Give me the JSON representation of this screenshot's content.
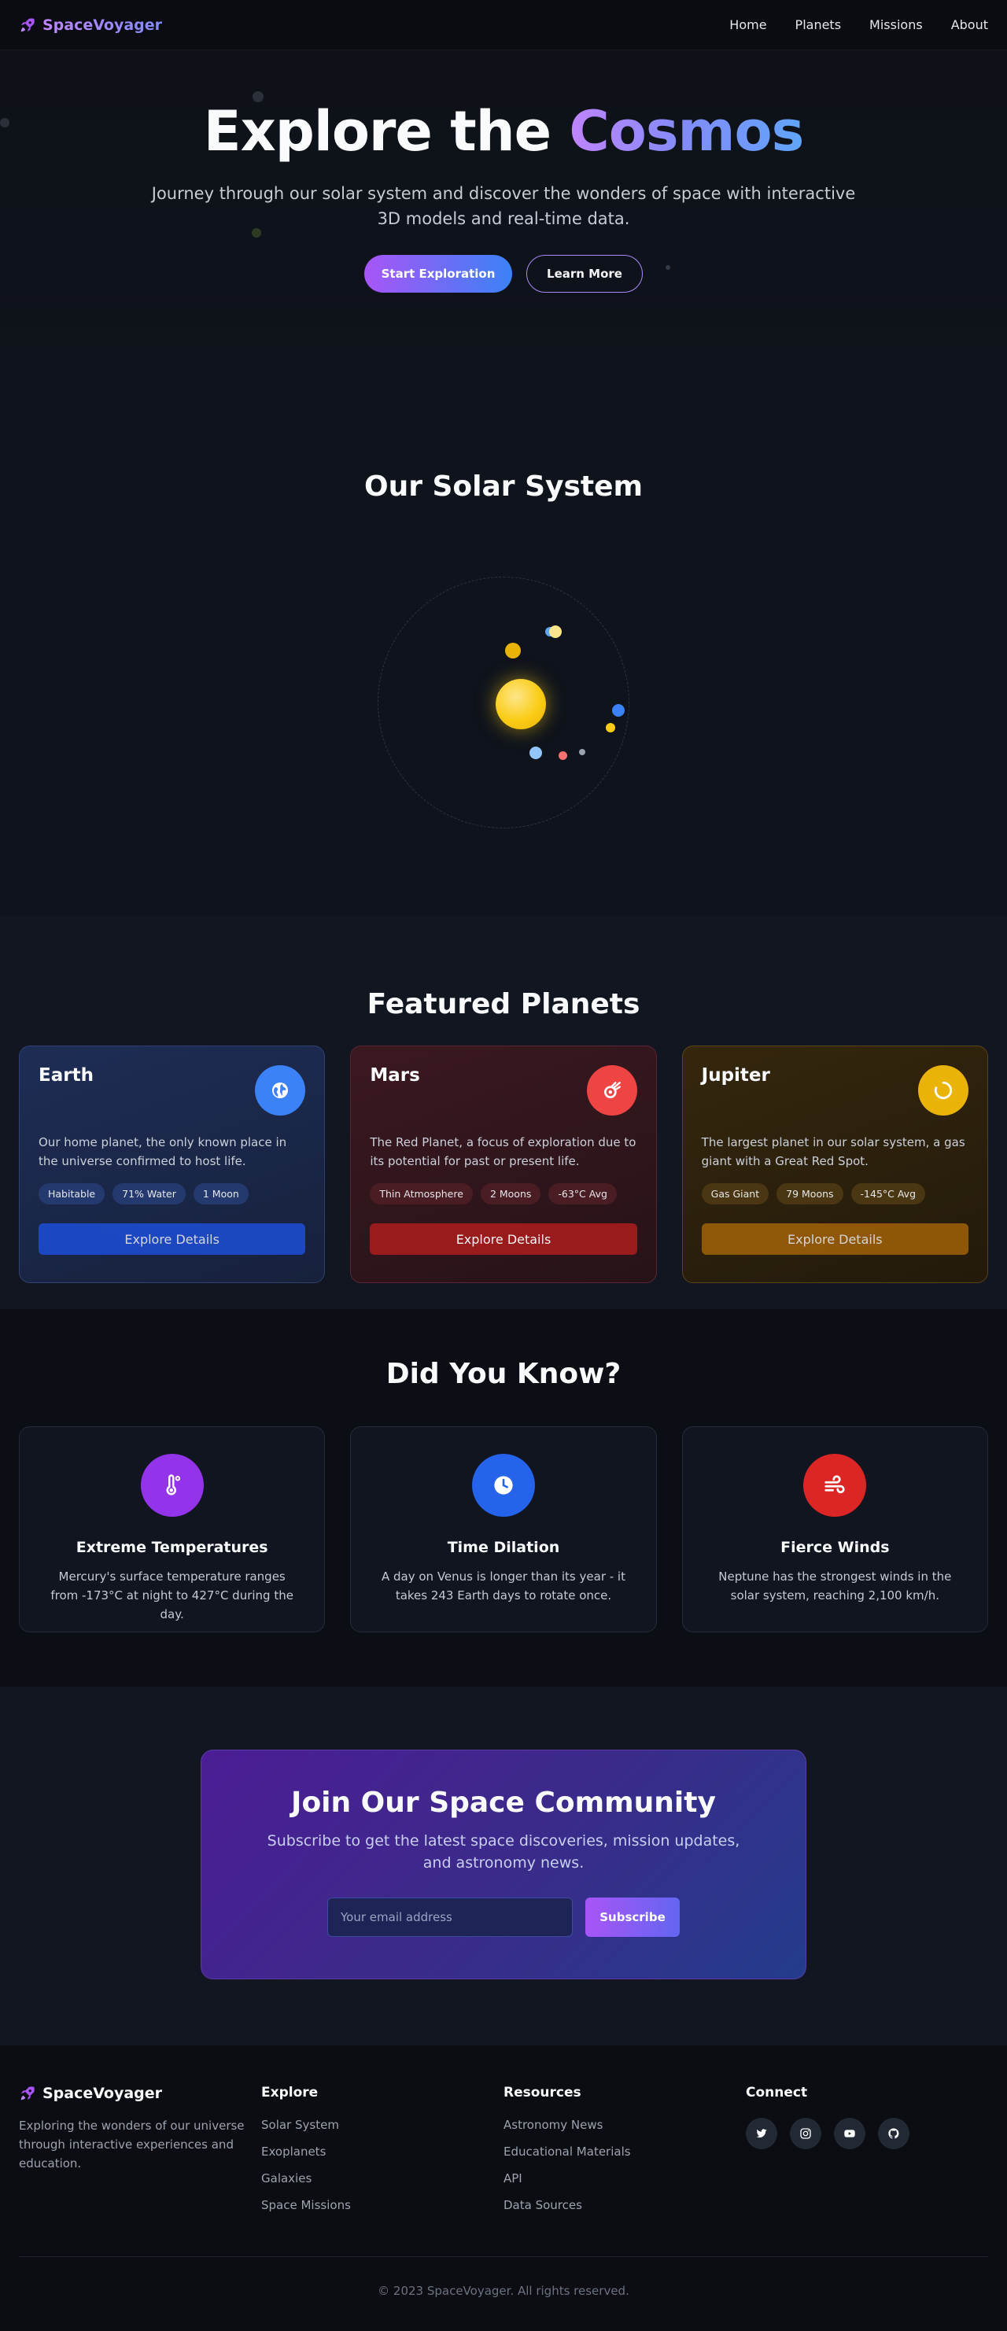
{
  "nav": {
    "brand": "SpaceVoyager",
    "links": [
      "Home",
      "Planets",
      "Missions",
      "About"
    ]
  },
  "hero": {
    "title_plain": "Explore the ",
    "title_accent": "Cosmos",
    "subtitle": "Journey through our solar system and discover the wonders of space with interactive 3D models and real-time data.",
    "primary_button": "Start Exploration",
    "secondary_button": "Learn More"
  },
  "solar": {
    "title": "Our Solar System"
  },
  "featured": {
    "title": "Featured Planets",
    "planets": [
      {
        "name": "Earth",
        "icon": "globe-icon",
        "description": "Our home planet, the only known place in the universe confirmed to host life.",
        "tags": [
          "Habitable",
          "71% Water",
          "1 Moon"
        ],
        "button": "Explore Details",
        "accent": "#3b82f6"
      },
      {
        "name": "Mars",
        "icon": "meteor-icon",
        "description": "The Red Planet, a focus of exploration due to its potential for past or present life.",
        "tags": [
          "Thin Atmosphere",
          "2 Moons",
          "-63°C Avg"
        ],
        "button": "Explore Details",
        "accent": "#ef4444"
      },
      {
        "name": "Jupiter",
        "icon": "ring-icon",
        "description": "The largest planet in our solar system, a gas giant with a Great Red Spot.",
        "tags": [
          "Gas Giant",
          "79 Moons",
          "-145°C Avg"
        ],
        "button": "Explore Details",
        "accent": "#eab308"
      }
    ]
  },
  "facts": {
    "title": "Did You Know?",
    "items": [
      {
        "title": "Extreme Temperatures",
        "icon": "thermometer-icon",
        "text": "Mercury's surface temperature ranges from -173°C at night to 427°C during the day.",
        "color": "#9333ea"
      },
      {
        "title": "Time Dilation",
        "icon": "clock-icon",
        "text": "A day on Venus is longer than its year - it takes 243 Earth days to rotate once.",
        "color": "#2563eb"
      },
      {
        "title": "Fierce Winds",
        "icon": "wind-icon",
        "text": "Neptune has the strongest winds in the solar system, reaching 2,100 km/h.",
        "color": "#dc2626"
      }
    ]
  },
  "community": {
    "title": "Join Our Space Community",
    "subtitle": "Subscribe to get the latest space discoveries, mission updates, and astronomy news.",
    "placeholder": "Your email address",
    "button": "Subscribe"
  },
  "footer": {
    "brand": "SpaceVoyager",
    "about": "Exploring the wonders of our universe through interactive experiences and education.",
    "explore_title": "Explore",
    "explore_links": [
      "Solar System",
      "Exoplanets",
      "Galaxies",
      "Space Missions"
    ],
    "resources_title": "Resources",
    "resources_links": [
      "Astronomy News",
      "Educational Materials",
      "API",
      "Data Sources"
    ],
    "connect_title": "Connect",
    "socials": [
      "twitter-icon",
      "instagram-icon",
      "youtube-icon",
      "github-icon"
    ],
    "copyright": "© 2023 SpaceVoyager. All rights reserved."
  }
}
